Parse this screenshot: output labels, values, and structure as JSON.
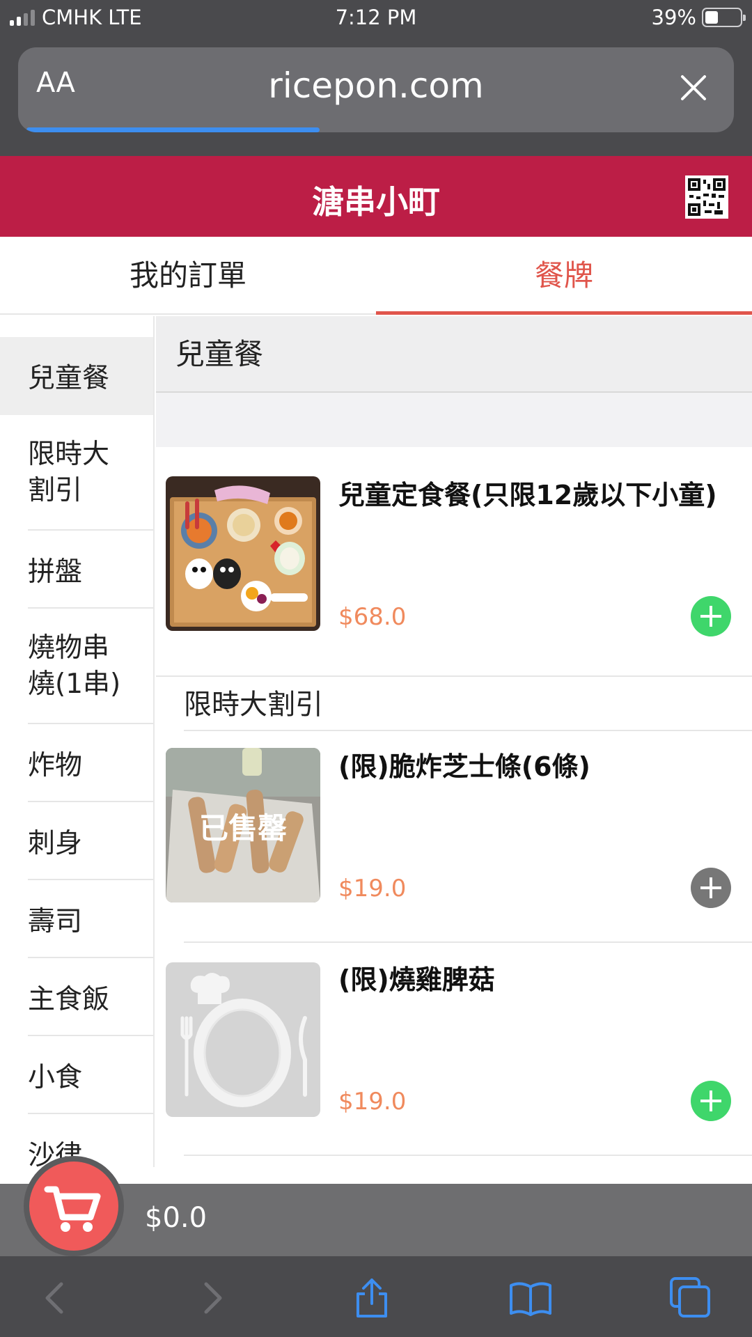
{
  "status_bar": {
    "carrier": "CMHK LTE",
    "time": "7:12 PM",
    "battery": "39%"
  },
  "browser": {
    "text_size_label": "AA",
    "url": "ricepon.com",
    "load_progress": 0.41
  },
  "app": {
    "title": "溏串小町"
  },
  "tabs": [
    {
      "label": "我的訂單",
      "active": false
    },
    {
      "label": "餐牌",
      "active": true
    }
  ],
  "sidebar": {
    "items": [
      {
        "label": "兒童餐",
        "active": true
      },
      {
        "label": "限時大割引"
      },
      {
        "label": "拼盤"
      },
      {
        "label": "燒物串燒(1串)"
      },
      {
        "label": "炸物"
      },
      {
        "label": "刺身"
      },
      {
        "label": "壽司"
      },
      {
        "label": "主食飯"
      },
      {
        "label": "小食"
      },
      {
        "label": "沙律"
      }
    ]
  },
  "menu": {
    "sections": [
      {
        "title": "兒童餐",
        "items": [
          {
            "name": "兒童定食餐(只限12歲以下小童)",
            "price": "$68.0",
            "available": true
          }
        ]
      },
      {
        "title": "限時大割引",
        "items": [
          {
            "name": "(限)脆炸芝士條(6條)",
            "price": "$19.0",
            "available": false,
            "status": "已售罄"
          },
          {
            "name": "(限)燒雞脾菇",
            "price": "$19.0",
            "available": true
          }
        ]
      }
    ]
  },
  "cart": {
    "total": "$0.0"
  },
  "colors": {
    "brand": "#bc1e46",
    "accent": "#e0554b",
    "price": "#f08a5d",
    "add_button": "#3fd66b",
    "cart_button": "#f05a5a",
    "safari_blue": "#3d8ef0"
  }
}
